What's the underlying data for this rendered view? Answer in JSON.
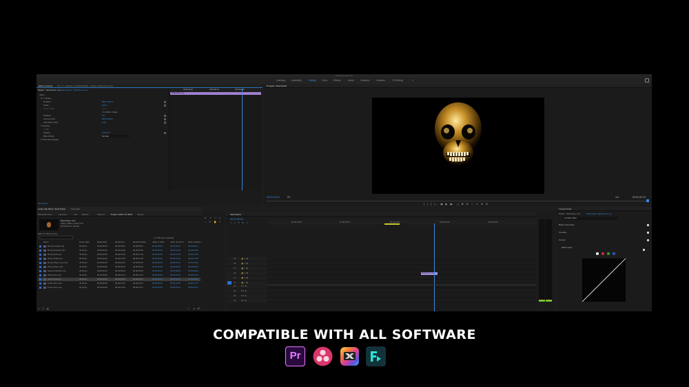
{
  "app": {
    "title": "Adobe Premiere Pro",
    "workspaces": [
      "Learning",
      "Assembly",
      "Editing",
      "Color",
      "Effects",
      "Audio",
      "Graphics",
      "Libraries",
      "FX Editing"
    ],
    "active_workspace": "Editing",
    "more_label": "»"
  },
  "effect_controls": {
    "tabs": [
      "Effect Controls",
      "Arri ‹?› ·ALEXA' & ‹SIGNATURE›",
      "Source: Skull Zoom Ann"
    ],
    "source_label": "Master * Skull Zoom.mov",
    "sequence_label": "Skull Spiral * Skull Zoom.mov",
    "timecodes": [
      "00:00:00:00",
      "00:00:05:12",
      "00:00:11:00"
    ],
    "clip_label": "Skull Zoom.mov",
    "footer_timecode": "00:01:00:02",
    "rows": [
      {
        "label": "Video",
        "value": ""
      },
      {
        "label": "fx ☐ Motion",
        "value": ""
      },
      {
        "label": "Position",
        "value": "960.0   540.0"
      },
      {
        "label": "Scale",
        "value": "100.0"
      },
      {
        "label": "Scale Width",
        "value": "100.0"
      },
      {
        "label": "",
        "value": "☑ Uniform Scale"
      },
      {
        "label": "Rotation",
        "value": "0.0"
      },
      {
        "label": "Anchor Point",
        "value": "960.0   540.0"
      },
      {
        "label": "Anti-flicker Filter",
        "value": "0.00"
      },
      {
        "label": "fx Opacity",
        "value": ""
      },
      {
        "label": "○ □ ✎",
        "value": ""
      },
      {
        "label": "Opacity",
        "value": "100.0 %"
      },
      {
        "label": "Blend Mode",
        "value": "Normal"
      },
      {
        "label": "fx Time Remapping",
        "value": ""
      }
    ]
  },
  "program": {
    "tab": "Program: Skull Spiral",
    "timecode_left": "00:01:00:02",
    "fit_label": "Fit",
    "quality_label": "1/4",
    "timecode_right": "00:01:00:13",
    "transport_icons": [
      "{",
      "|",
      "}",
      "|←",
      "◀|",
      "▶",
      "|▶",
      "→|",
      "⊞",
      "⊟",
      "⬚",
      "✂",
      "⟲",
      "⊡",
      "+"
    ]
  },
  "audio_mixer": {
    "tabs": [
      "Audio Clip Mixer: Skull Spiral",
      "Metadata"
    ]
  },
  "project": {
    "tabs": [
      "Media Browser",
      "Libraries",
      "Info",
      "Effects",
      "Markers",
      "Project: 2021 TC WCA",
      "History"
    ],
    "project_name": "2021 TC WCA.prproj",
    "preview_name": "Skull Zoom.mov",
    "preview_info": "Video, 3840 x 2160 (1.0)",
    "preview_info2": "00:00:01:15, 30.00p",
    "items_selected": "1 of 55 items selected",
    "headers": [
      "Name",
      "Frame Rate",
      "Media Start",
      "Media End",
      "Media Duration",
      "Video In Point",
      "Video Out Point",
      "Video Duration"
    ],
    "rows": [
      [
        "Money Portals.mp4",
        "30.00 fps",
        "00:00:00:00",
        "00:00:05:06",
        "00:00:05:07",
        "00:00:00:00",
        "00:00:05:06",
        "00:00:05:07"
      ],
      [
        "Money Portals2.mp4",
        "30.00 fps",
        "00:00:00:00",
        "00:00:04:28",
        "00:00:04:29",
        "00:00:00:00",
        "00:00:04:28",
        "00:00:04:29"
      ],
      [
        "Money Roll.mp4",
        "30.00 fps",
        "00:00:00:00",
        "00:00:07:28",
        "00:00:07:29",
        "00:00:00:00",
        "00:00:07:28",
        "00:00:07:29"
      ],
      [
        "Money Roll2.mp4",
        "30.00 fps",
        "00:00:00:00",
        "00:00:07:28",
        "00:00:07:29",
        "00:00:00:00",
        "00:00:07:28",
        "00:00:07:29"
      ],
      [
        "Money Wave Loop.mp4",
        "30.00 fps",
        "00:00:00:00",
        "00:00:03:21",
        "00:00:03:22",
        "00:00:00:00",
        "00:00:03:21",
        "00:00:03:22"
      ],
      [
        "Money Wave.mp4",
        "30.00 fps",
        "00:00:00:00",
        "00:00:09:23",
        "00:00:09:24",
        "00:00:00:00",
        "00:00:09:23",
        "00:00:09:24"
      ],
      [
        "Samurai Wind01.mov",
        "30.00 fps",
        "00:00:00:00",
        "00:00:08:28",
        "00:00:08:29",
        "00:00:00:00",
        "00:00:08:28",
        "00:00:08:29"
      ],
      [
        "Skull Zoom.mov",
        "30.00 fps",
        "00:00:00:00",
        "00:00:01:14",
        "00:00:01:15",
        "00:00:00:00",
        "00:00:01:14",
        "00:00:01:15"
      ],
      [
        "Skull Spiral.mov",
        "30.00 fps",
        "00:00:00:00",
        "00:00:02:00",
        "00:00:02:01",
        "00:00:00:00",
        "00:00:02:00",
        "00:00:02:01"
      ],
      [
        "Tower Fires.mp4",
        "30.00 fps",
        "00:00:00:00",
        "00:00:12:06",
        "00:00:12:07",
        "00:00:00:00",
        "00:00:12:06",
        "00:00:12:07"
      ],
      [
        "Tower Fires.mp4",
        "30.00 fps",
        "00:00:00:00",
        "00:00:12:06",
        "00:00:12:07",
        "00:00:00:00",
        "00:00:12:06",
        "00:00:12:07"
      ]
    ]
  },
  "timeline": {
    "tab": "Skull Spiral",
    "timecode": "00:01:00:02",
    "ruler": [
      "00:00:00:00",
      "00:00:05:00",
      "00:01:00:00",
      "00:00:15:00",
      "00:00:20:00"
    ],
    "video_tracks": [
      "V6",
      "V5",
      "V4",
      "V3",
      "V2",
      "V1"
    ],
    "audio_tracks": [
      "A1",
      "A2",
      "A3",
      "A4"
    ],
    "clip_label": "Skull Zoom.mov"
  },
  "lumetri": {
    "tab": "Lumetri Color",
    "source_label": "Master * Skull Zoom.mov",
    "sequence_label": "Skull Spiral * Skull Zoom.mov",
    "effect_select": "Lumetri Color",
    "sections": [
      "Basic Correction",
      "Creative",
      "Curves"
    ],
    "rgb_curves_label": "RGB Curves",
    "dot_colors": [
      "#ffffff",
      "#d23030",
      "#2f9e3a",
      "#2f58d2"
    ]
  },
  "footer": {
    "tagline": "COMPATIBLE WITH ALL SOFTWARE",
    "icons": [
      {
        "name": "premiere-pro-icon",
        "label": "Pr"
      },
      {
        "name": "davinci-resolve-icon",
        "label": ""
      },
      {
        "name": "final-cut-pro-icon",
        "label": ""
      },
      {
        "name": "filmora-icon",
        "label": ""
      }
    ]
  },
  "colors": {
    "accent": "#2d8ceb",
    "clip": "#a58fe0",
    "premiere": "#2a0a3e",
    "premiere_text": "#e77bff"
  }
}
